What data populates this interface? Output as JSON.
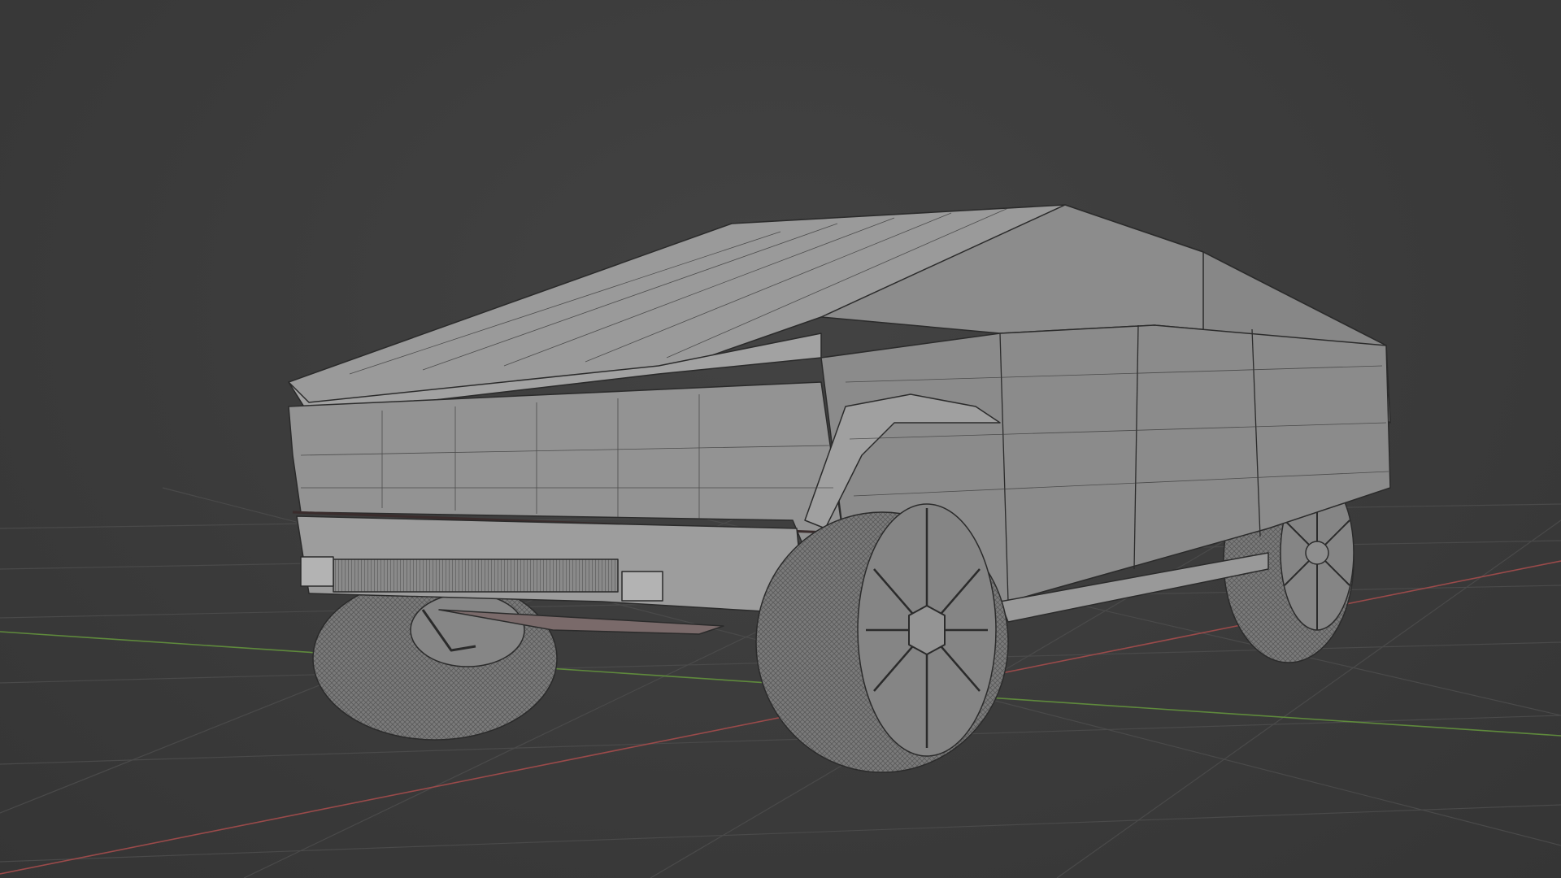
{
  "viewport": {
    "background_color": "#3d3d3d",
    "grid_color": "#4a4a4a",
    "x_axis_color": "#9a4a4a",
    "y_axis_color": "#5f8a3c"
  },
  "model": {
    "name_icon": "pickup-truck-wireframe",
    "body_color": "#8f8f8f",
    "edge_color": "#2a2a2a",
    "tire_color": "#777777"
  }
}
